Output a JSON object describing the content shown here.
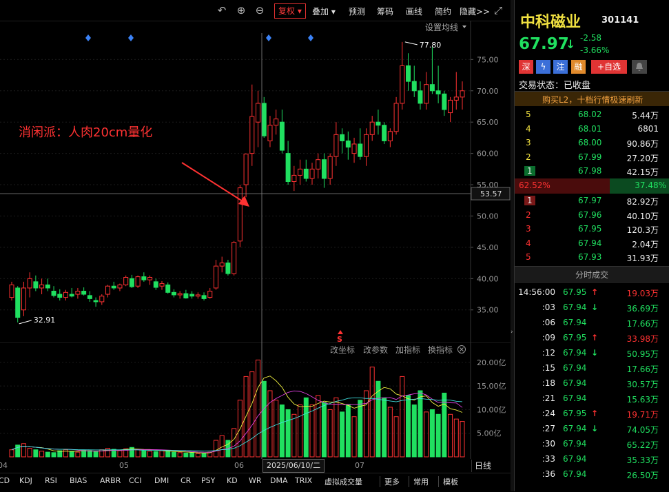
{
  "toolbar": {
    "fuquan": "复权",
    "items": [
      "叠加",
      "预测",
      "筹码",
      "画线",
      "简约",
      "隐藏>>"
    ],
    "undo_icon": "undo-icon",
    "zoom_in_icon": "zoom-in-icon",
    "zoom_out_icon": "zoom-out-icon",
    "fullscreen_icon": "fullscreen-icon"
  },
  "kchart": {
    "ma_setting": "设置均线",
    "annotation": "消闲派：人肉20cm量化",
    "y_labels": [
      "75.00",
      "70.00",
      "65.00",
      "60.00",
      "55.00",
      "50.00",
      "45.00",
      "40.00",
      "35.00"
    ],
    "crosshair_price": "53.57",
    "high_label": "77.80",
    "low_label": "32.91",
    "signal_marker": "S"
  },
  "chart_data": {
    "type": "candlestick",
    "ylim": [
      32,
      79
    ],
    "candles": [
      [
        37,
        39.5,
        36.5,
        39
      ],
      [
        38.5,
        38.8,
        33,
        33.8
      ],
      [
        35,
        39.5,
        34,
        38.5
      ],
      [
        38.5,
        41,
        37,
        40
      ],
      [
        39.5,
        40.5,
        38,
        38.5
      ],
      [
        38.5,
        40,
        37.5,
        39
      ],
      [
        39,
        40,
        38,
        38.5
      ],
      [
        38,
        38.8,
        37,
        37.3
      ],
      [
        37.5,
        38.3,
        36.5,
        37
      ],
      [
        37,
        38.2,
        36.5,
        37.8
      ],
      [
        37.5,
        38.5,
        37,
        37.2
      ],
      [
        37.5,
        38.5,
        36.8,
        38
      ],
      [
        38,
        38.6,
        37.3,
        37.5
      ],
      [
        37.3,
        38,
        36.3,
        36.8
      ],
      [
        36.5,
        37,
        35.5,
        36.3
      ],
      [
        36.3,
        37.5,
        35.8,
        37.2
      ],
      [
        37.5,
        39,
        37,
        38.8
      ],
      [
        38.8,
        39.5,
        38.2,
        38.5
      ],
      [
        38.5,
        39.2,
        38,
        39
      ],
      [
        39,
        40.5,
        38.8,
        40.2
      ],
      [
        40,
        40.6,
        38.5,
        38.7
      ],
      [
        38.8,
        40.5,
        38.5,
        40.3
      ],
      [
        40.3,
        41,
        39.5,
        39.8
      ],
      [
        39.8,
        40.5,
        39,
        40.2
      ],
      [
        39.5,
        40,
        38.2,
        38.6
      ],
      [
        38.8,
        39.6,
        38.2,
        39.2
      ],
      [
        39,
        39.4,
        37.6,
        37.8
      ],
      [
        37.8,
        38.3,
        37,
        37.4
      ],
      [
        37.4,
        38,
        36.8,
        37.6
      ],
      [
        37.6,
        38.2,
        36.8,
        36.9
      ],
      [
        37.5,
        38,
        36.8,
        37.2
      ],
      [
        37.2,
        37.8,
        36.8,
        37.4
      ],
      [
        37.3,
        37.8,
        36.5,
        36.8
      ],
      [
        37,
        38.5,
        36.8,
        38
      ],
      [
        38.5,
        43,
        38.2,
        42
      ],
      [
        42,
        43.5,
        41,
        42.5
      ],
      [
        42.5,
        43,
        40.5,
        40.8
      ],
      [
        40.8,
        46,
        40.5,
        45.8
      ],
      [
        46,
        55,
        45,
        54.5
      ],
      [
        55,
        60,
        53,
        59.9
      ],
      [
        60,
        71,
        58,
        65.9
      ],
      [
        65,
        70,
        61,
        68
      ],
      [
        68,
        69,
        62.5,
        62.8
      ],
      [
        62,
        66,
        61,
        64.5
      ],
      [
        64.5,
        67,
        63,
        65.5
      ],
      [
        65,
        67,
        60,
        60.5
      ],
      [
        60,
        62,
        55,
        55.5
      ],
      [
        55.5,
        58,
        54,
        56.5
      ],
      [
        56.5,
        59,
        55,
        57.5
      ],
      [
        57.5,
        59,
        55.5,
        56
      ],
      [
        56,
        58.5,
        55,
        57.5
      ],
      [
        57.5,
        60,
        56,
        59
      ],
      [
        59,
        60,
        54.5,
        56
      ],
      [
        56,
        60,
        55,
        59.5
      ],
      [
        59.5,
        65,
        58,
        63
      ],
      [
        63,
        64,
        60,
        62
      ],
      [
        62,
        63.5,
        59,
        61
      ],
      [
        60,
        62.5,
        58.5,
        61.5
      ],
      [
        61.5,
        64,
        59,
        59.5
      ],
      [
        59.5,
        64,
        58,
        63
      ],
      [
        63,
        66,
        62,
        65
      ],
      [
        65,
        67,
        63,
        64.5
      ],
      [
        64.5,
        65,
        61.5,
        62
      ],
      [
        62,
        64,
        61,
        63.5
      ],
      [
        63.5,
        69,
        63,
        68
      ],
      [
        68,
        77.8,
        67,
        74
      ],
      [
        74,
        76,
        70,
        71.5
      ],
      [
        71.5,
        74,
        69,
        70
      ],
      [
        70,
        71.5,
        67,
        68
      ],
      [
        68,
        73,
        67,
        71
      ],
      [
        71,
        77,
        69.5,
        70
      ],
      [
        70,
        74,
        68,
        69.5
      ],
      [
        69.5,
        70,
        66,
        67
      ],
      [
        66.5,
        69,
        65,
        68.5
      ],
      [
        68.5,
        73,
        67,
        69
      ],
      [
        69,
        71.5,
        67,
        70
      ]
    ],
    "volume": {
      "y_labels": [
        "20.00亿",
        "15.00亿",
        "10.00亿",
        "5.00亿"
      ],
      "ymax": 21,
      "values": [
        1.5,
        2.5,
        2.8,
        1.8,
        1.5,
        1.2,
        1,
        0.9,
        1.3,
        1.5,
        1.2,
        1,
        1.4,
        1.3,
        1.1,
        1.5,
        1.8,
        1.6,
        1.3,
        1.7,
        2,
        1.6,
        1.3,
        1.2,
        1.1,
        1.3,
        1.2,
        1,
        0.9,
        0.8,
        0.9,
        0.7,
        0.8,
        1,
        3.5,
        4.5,
        3.5,
        6,
        12,
        17,
        18,
        20.5,
        16,
        14,
        12,
        11,
        10,
        9,
        11,
        12.5,
        11,
        13,
        11.5,
        10,
        12.5,
        9.5,
        11,
        8.5,
        12,
        14,
        19,
        16,
        12.5,
        10.5,
        8.5,
        17,
        13,
        11,
        14,
        9.5,
        10,
        9,
        13.5,
        9,
        8,
        7.5
      ]
    },
    "x_labels": [
      "04",
      "05",
      "06",
      "07"
    ],
    "crosshair_date": "2025/06/10/二"
  },
  "vol_panel": {
    "tools": [
      "改坐标",
      "改参数",
      "加指标",
      "换指标"
    ],
    "close_icon": "close-icon"
  },
  "indicator_tabs": [
    "CD",
    "KDJ",
    "RSI",
    "BIAS",
    "ARBR",
    "CCI",
    "DMI",
    "CR",
    "PSY",
    "KD",
    "WR",
    "DMA",
    "TRIX",
    "虚拟成交量",
    "更多",
    "常用",
    "模板"
  ],
  "right_axis_label": "日线",
  "quote": {
    "name": "中科磁业",
    "code": "301141",
    "price": "67.97",
    "arrow": "↓",
    "change": "-2.58",
    "change_pct": "-3.66%",
    "tags": [
      "深",
      "ϟ",
      "注",
      "融",
      "+自选"
    ],
    "bell_icon": "bell-icon",
    "trade_status": "交易状态：已收盘",
    "l2_banner": "购买L2，十档行情极速刷新"
  },
  "order_book": {
    "asks": [
      {
        "level": "5",
        "price": "68.02",
        "vol": "5.44万"
      },
      {
        "level": "4",
        "price": "68.01",
        "vol": "6801"
      },
      {
        "level": "3",
        "price": "68.00",
        "vol": "90.86万"
      },
      {
        "level": "2",
        "price": "67.99",
        "vol": "27.20万"
      },
      {
        "level": "1",
        "price": "67.98",
        "vol": "42.15万"
      }
    ],
    "ratio_left": "62.52%",
    "ratio_right": "37.48%",
    "bids": [
      {
        "level": "1",
        "price": "67.97",
        "vol": "82.92万"
      },
      {
        "level": "2",
        "price": "67.96",
        "vol": "40.10万"
      },
      {
        "level": "3",
        "price": "67.95",
        "vol": "120.3万"
      },
      {
        "level": "4",
        "price": "67.94",
        "vol": "2.04万"
      },
      {
        "level": "5",
        "price": "67.93",
        "vol": "31.93万"
      }
    ]
  },
  "ticks": {
    "title": "分时成交",
    "rows": [
      {
        "time": "14:56:00",
        "price": "67.95",
        "dir": "↑",
        "vol": "19.03万",
        "c": "red"
      },
      {
        "time": ":03",
        "price": "67.94",
        "dir": "↓",
        "vol": "36.69万",
        "c": "green"
      },
      {
        "time": ":06",
        "price": "67.94",
        "dir": "",
        "vol": "17.66万",
        "c": "green"
      },
      {
        "time": ":09",
        "price": "67.95",
        "dir": "↑",
        "vol": "33.98万",
        "c": "red"
      },
      {
        "time": ":12",
        "price": "67.94",
        "dir": "↓",
        "vol": "50.95万",
        "c": "green"
      },
      {
        "time": ":15",
        "price": "67.94",
        "dir": "",
        "vol": "17.66万",
        "c": "green"
      },
      {
        "time": ":18",
        "price": "67.94",
        "dir": "",
        "vol": "30.57万",
        "c": "green"
      },
      {
        "time": ":21",
        "price": "67.94",
        "dir": "",
        "vol": "15.63万",
        "c": "green"
      },
      {
        "time": ":24",
        "price": "67.95",
        "dir": "↑",
        "vol": "19.71万",
        "c": "red"
      },
      {
        "time": ":27",
        "price": "67.94",
        "dir": "↓",
        "vol": "74.05万",
        "c": "green"
      },
      {
        "time": ":30",
        "price": "67.94",
        "dir": "",
        "vol": "65.22万",
        "c": "green"
      },
      {
        "time": ":33",
        "price": "67.94",
        "dir": "",
        "vol": "35.33万",
        "c": "green"
      },
      {
        "time": ":36",
        "price": "67.94",
        "dir": "",
        "vol": "26.50万",
        "c": "green"
      }
    ]
  }
}
